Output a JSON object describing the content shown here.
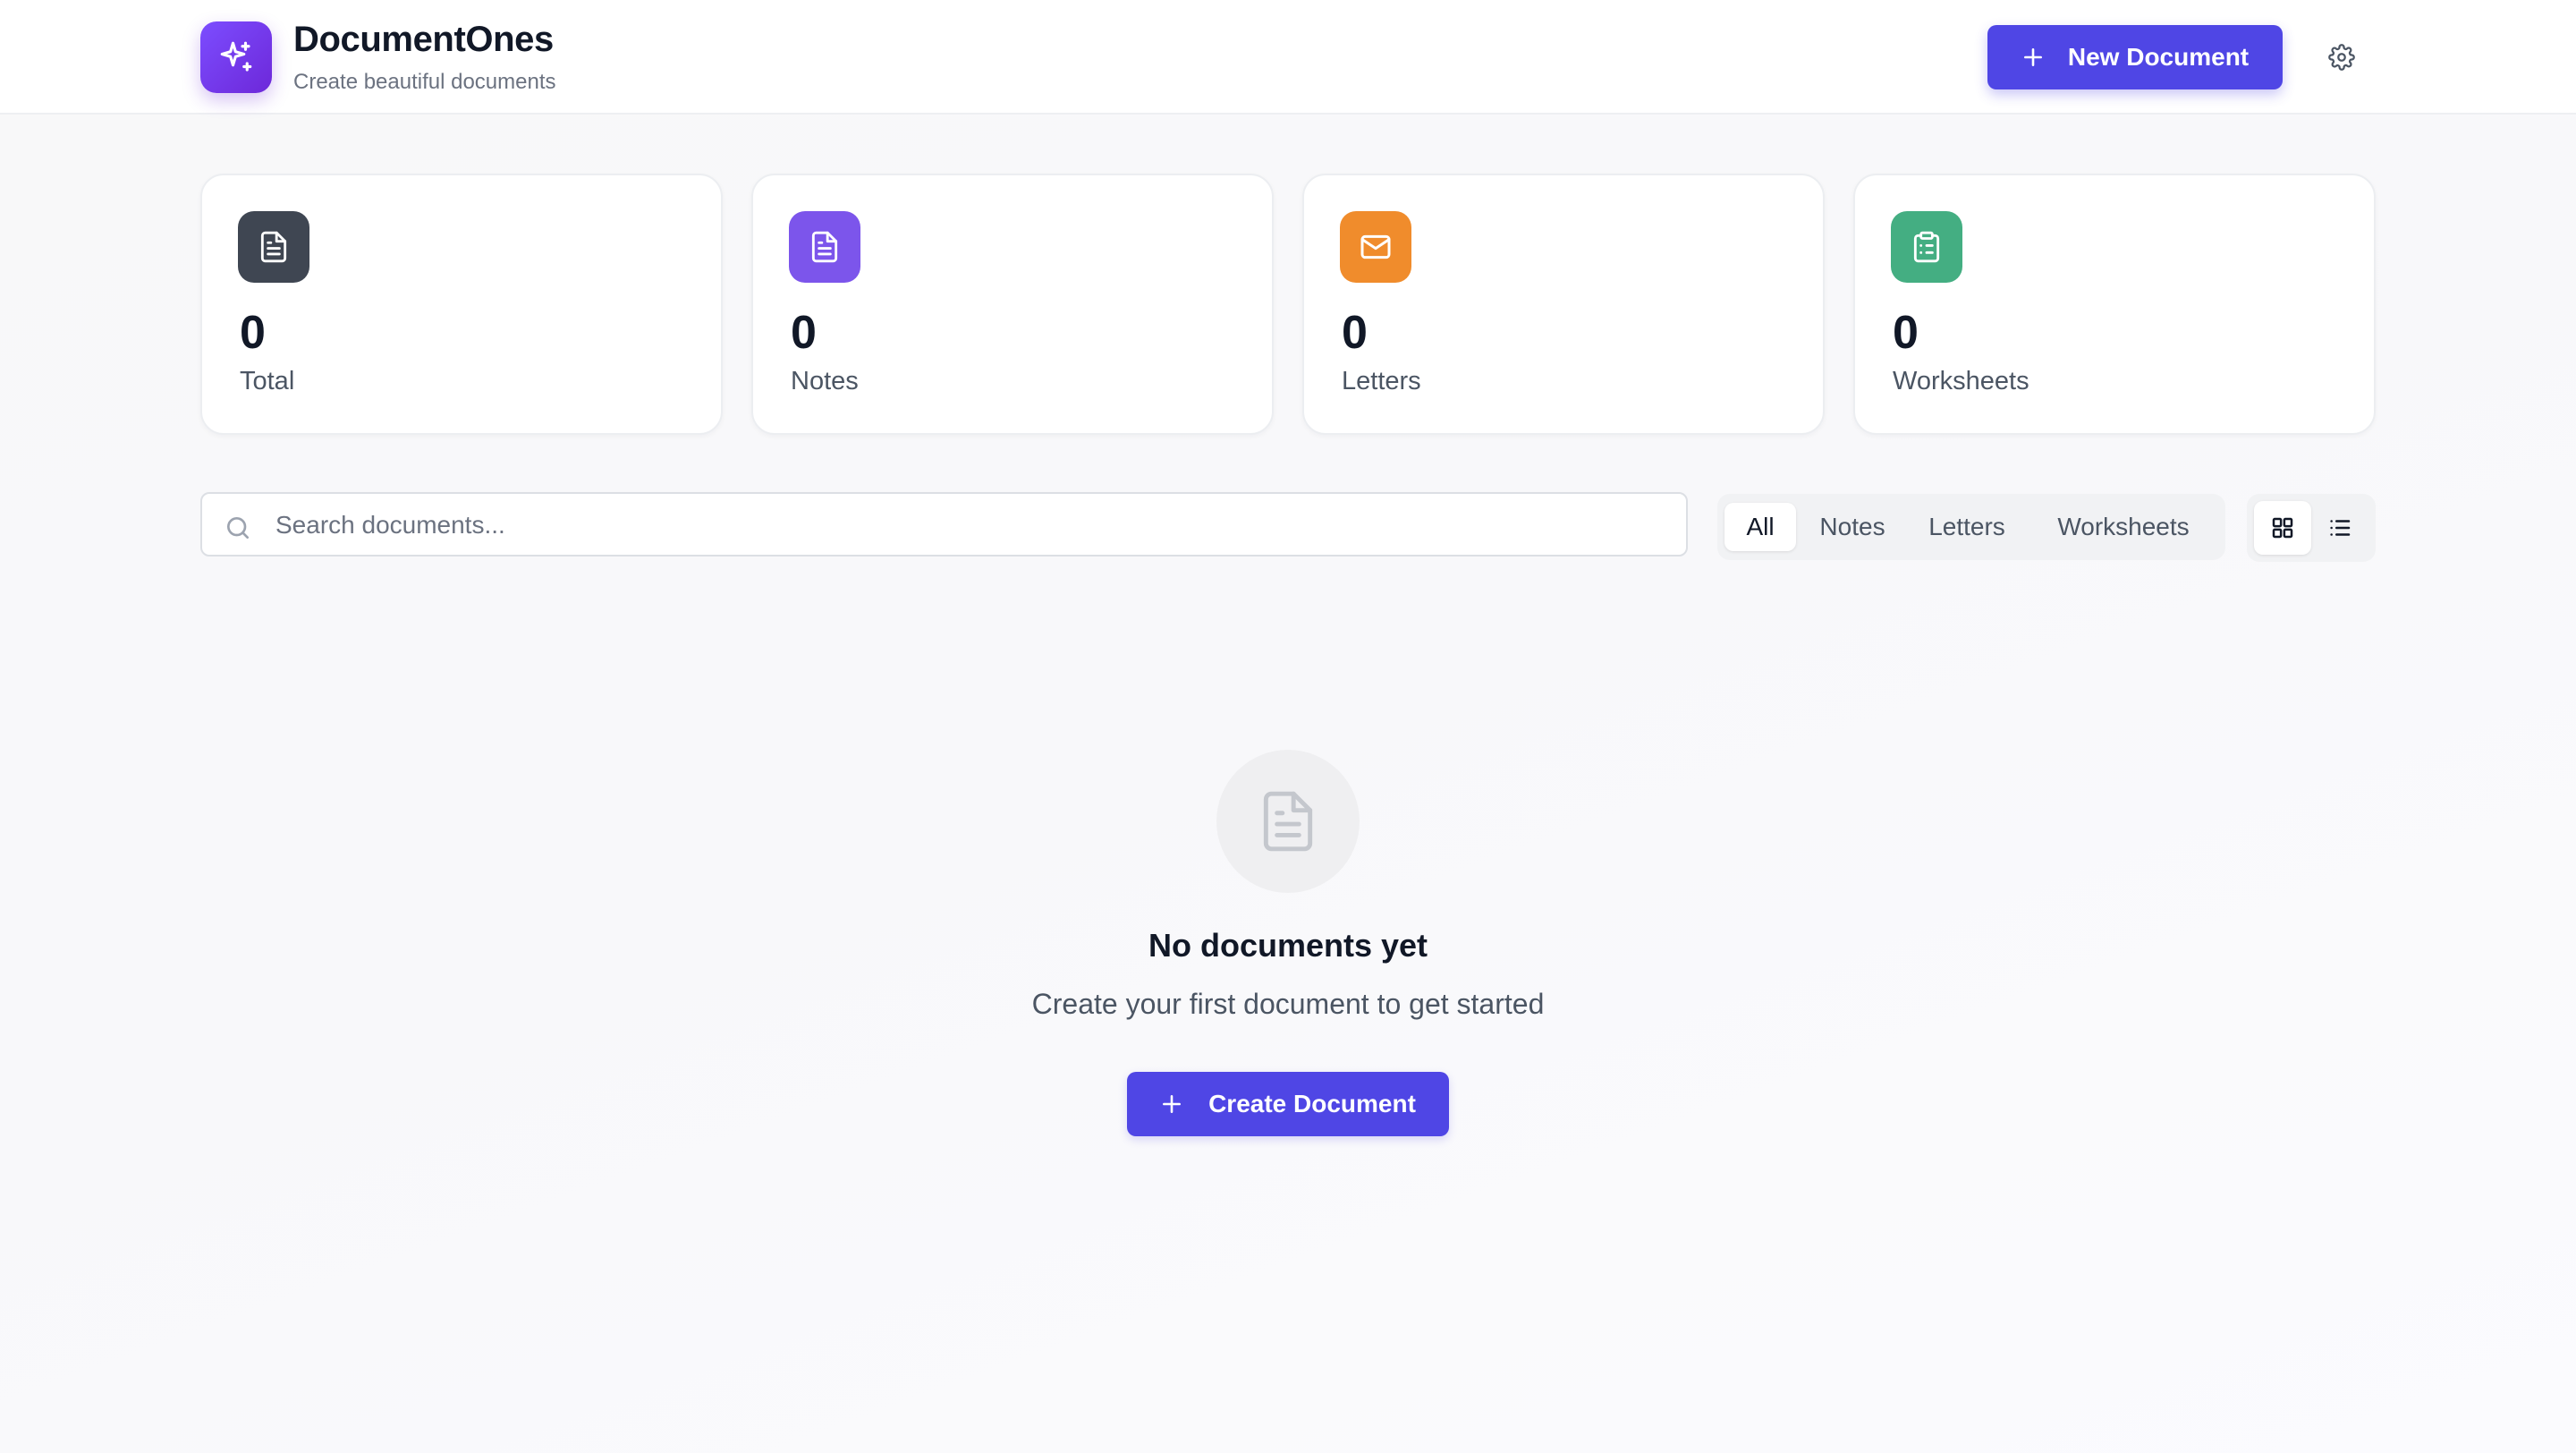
{
  "app": {
    "title": "DocumentOnes",
    "subtitle": "Create beautiful documents",
    "logo_icon": "sparkles-icon",
    "accent_color": "#4f46e5"
  },
  "header": {
    "new_document_label": "New Document",
    "new_document_icon": "plus-icon",
    "settings_icon": "gear-icon"
  },
  "stats": [
    {
      "value": "0",
      "label": "Total",
      "icon": "file-text-icon",
      "color": "#3f4652"
    },
    {
      "value": "0",
      "label": "Notes",
      "icon": "file-text-icon",
      "color": "#7c55eb"
    },
    {
      "value": "0",
      "label": "Letters",
      "icon": "mail-icon",
      "color": "#f08c2c"
    },
    {
      "value": "0",
      "label": "Worksheets",
      "icon": "clipboard-list-icon",
      "color": "#44ae82"
    }
  ],
  "search": {
    "placeholder": "Search documents...",
    "value": "",
    "icon": "search-icon"
  },
  "filters": {
    "tabs": [
      "All",
      "Notes",
      "Letters",
      "Worksheets"
    ],
    "active": "All"
  },
  "view_toggle": {
    "options": [
      "grid-icon",
      "list-icon"
    ],
    "active": "grid-icon"
  },
  "empty_state": {
    "icon": "file-text-icon",
    "title": "No documents yet",
    "subtitle": "Create your first document to get started",
    "button_label": "Create Document",
    "button_icon": "plus-icon"
  }
}
